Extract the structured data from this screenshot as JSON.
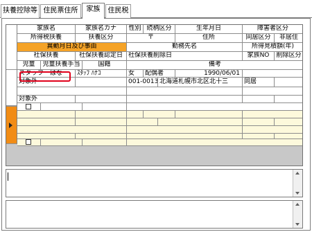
{
  "tabs": [
    {
      "label": "扶養控除等"
    },
    {
      "label": "住民票住所"
    },
    {
      "label": "家族"
    },
    {
      "label": "住民税"
    }
  ],
  "header": {
    "row1": [
      "家族名",
      "家族名カナ",
      "性別",
      "続柄区分",
      "生年月日",
      "障害者区分"
    ],
    "row2": [
      "所得税扶養",
      "扶養区分",
      "〒",
      "住所",
      "同居区分",
      "非居住"
    ],
    "row3": [
      "異動月日及び事由",
      "勤務先名",
      "所得見積額(年)"
    ],
    "row4": [
      "社保扶養",
      "社保扶養認定日",
      "社保扶養削除日",
      "家族NO",
      "削除区分"
    ],
    "row5": [
      "児童",
      "児童扶養手当",
      "国籍",
      "備考"
    ]
  },
  "record1": {
    "name": "スタッフ　はな",
    "kana": "ｽﾀｯﾌ ﾊﾅｺ",
    "gender": "女",
    "relation": "配偶者",
    "birthdate": "1990/06/01",
    "tax_dependent": "対象外",
    "postal": "001-0013",
    "address": "北海道札幌市北区北十三",
    "cohabit": "同居",
    "social_dependent": "対象外"
  },
  "colors": {
    "orange_header": "#f5a327",
    "row_marker": "#f18c15",
    "yellow_row": "#fdf9dc",
    "highlight": "#e0001b"
  }
}
